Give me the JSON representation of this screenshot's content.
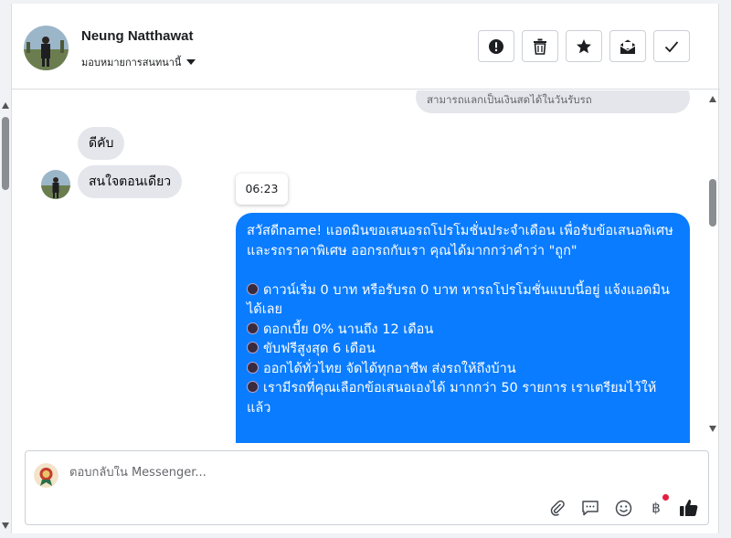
{
  "header": {
    "contact_name": "Neung Natthawat",
    "assign_label": "มอบหมายการสนทนานี้",
    "actions": [
      {
        "name": "spam-button",
        "icon": "alert-circle-icon"
      },
      {
        "name": "delete-button",
        "icon": "trash-icon"
      },
      {
        "name": "star-button",
        "icon": "star-icon"
      },
      {
        "name": "mark-unread-button",
        "icon": "mail-open-icon"
      },
      {
        "name": "done-button",
        "icon": "check-icon"
      }
    ]
  },
  "messages": {
    "top_partial": "สามารถแลกเป็นเงินสดได้ในวันรับรถ",
    "incoming": [
      "ดีคับ",
      "สนใจตอนเดียว"
    ],
    "timestamp": "06:23",
    "outgoing": {
      "intro": "สวัสดีname! แอดมินขอเสนอรถโปรโมชั่นประจำเดือน เพื่อรับข้อเสนอพิเศษ และรถราคาพิเศษ ออกรถกับเรา คุณได้มากกว่าคำว่า \"ถูก\"",
      "items": [
        "ดาวน์เริ่ม 0 บาท หรือรับรถ 0 บาท หารถโปรโมชั่นแบบนี้อยู่ แจ้งแอดมินได้เลย",
        "ดอกเบี้ย 0% นานถึง 12 เดือน",
        "ขับฟรีสูงสุด 6 เดือน",
        "ออกได้ทั่วไทย จัดได้ทุกอาชีพ ส่งรถให้ถึงบ้าน",
        "เรามีรถที่คุณเลือกข้อเสนอเองได้ มากกว่า 50 รายการ เราเตรียมไว้ให้แล้ว"
      ]
    }
  },
  "composer": {
    "placeholder": "ตอบกลับใน Messenger...",
    "tools": [
      "paperclip-icon",
      "comment-icon",
      "emoji-icon",
      "baht-icon",
      "thumbs-up-icon"
    ]
  },
  "colors": {
    "accent": "#0a7cff",
    "bubble_in": "#e4e6eb",
    "notify": "#e41e3f"
  }
}
